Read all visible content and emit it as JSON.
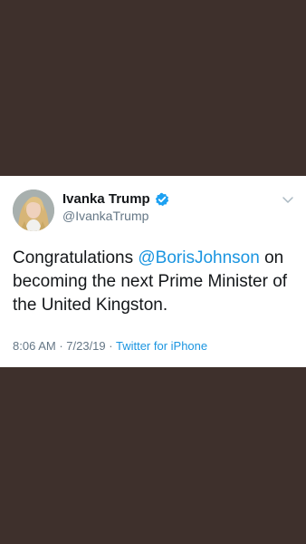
{
  "tweet": {
    "display_name": "Ivanka Trump",
    "handle": "@IvankaTrump",
    "text_before": "Congratulations ",
    "mention": "@BorisJohnson",
    "text_after": " on becoming the next Prime Minister of the United Kingston.",
    "time": "8:06 AM",
    "separator_1": " · ",
    "date": "7/23/19",
    "separator_2": " · ",
    "source": "Twitter for iPhone",
    "verified": true
  },
  "colors": {
    "background": "#3e302c",
    "card": "#ffffff",
    "text": "#14171a",
    "secondary_text": "#657786",
    "link": "#1b95e0",
    "verified_badge": "#1da1f2"
  },
  "icons": {
    "verified": "verified-badge-icon",
    "more": "chevron-down-icon"
  }
}
